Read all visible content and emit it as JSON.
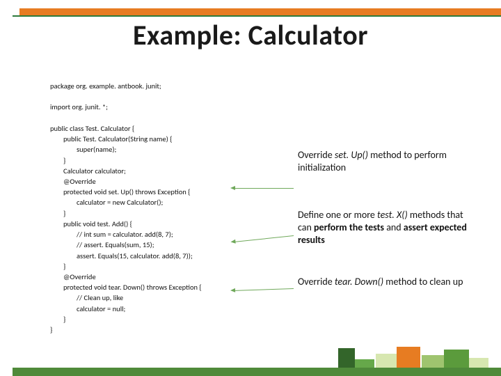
{
  "title": "Example: Calculator",
  "code": "package org. example. antbook. junit;\n\nimport org. junit. *;\n\npublic class Test. Calculator {\n        public Test. Calculator(String name) {\n                super(name);\n        }\n        Calculator calculator;\n        @Override\n        protected void set. Up() throws Exception {\n                calculator = new Calculator();\n        }\n        public void test. Add() {\n                // int sum = calculator. add(8, 7);\n                // assert. Equals(sum, 15);\n                assert. Equals(15, calculator. add(8, 7));\n        }\n        @Override\n        protected void tear. Down() throws Exception {\n                // Clean up, like\n                calculator = null;\n        }\n}",
  "notes": {
    "n1_a": "Override ",
    "n1_b": "set. Up()",
    "n1_c": " method to perform initialization",
    "n2_a": "Define one or more ",
    "n2_b": "test. X()",
    "n2_c": " methods that can ",
    "n2_d": "perform the tests",
    "n2_e": " and ",
    "n2_f": "assert expected results",
    "n3_a": "Override ",
    "n3_b": "tear. Down()",
    "n3_c": " method to clean up"
  }
}
